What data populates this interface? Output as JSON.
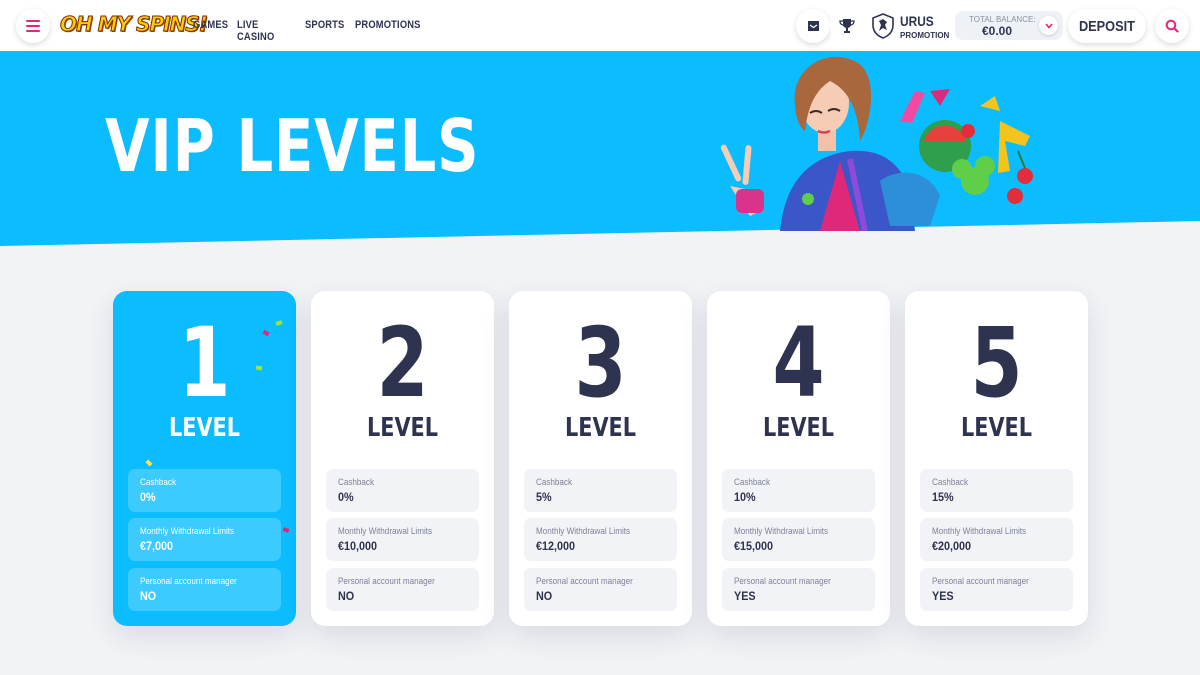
{
  "header": {
    "logo": "OH MY SPINS!",
    "nav": [
      "GAMES",
      "LIVE CASINO",
      "SPORTS",
      "PROMOTIONS"
    ],
    "user": {
      "name": "URUS",
      "status": "PROMOTION"
    },
    "balance": {
      "label": "TOTAL BALANCE:",
      "value": "€0.00"
    },
    "deposit_label": "DEPOSIT"
  },
  "hero": {
    "title": "VIP LEVELS"
  },
  "levels": [
    {
      "number": "1",
      "label": "LEVEL",
      "cashback_label": "Cashback",
      "cashback": "0%",
      "withdrawal_label": "Monthly Withdrawal Limits",
      "withdrawal": "€7,000",
      "manager_label": "Personal account manager",
      "manager": "NO"
    },
    {
      "number": "2",
      "label": "LEVEL",
      "cashback_label": "Cashback",
      "cashback": "0%",
      "withdrawal_label": "Monthly Withdrawal Limits",
      "withdrawal": "€10,000",
      "manager_label": "Personal account manager",
      "manager": "NO"
    },
    {
      "number": "3",
      "label": "LEVEL",
      "cashback_label": "Cashback",
      "cashback": "5%",
      "withdrawal_label": "Monthly Withdrawal Limits",
      "withdrawal": "€12,000",
      "manager_label": "Personal account manager",
      "manager": "NO"
    },
    {
      "number": "4",
      "label": "LEVEL",
      "cashback_label": "Cashback",
      "cashback": "10%",
      "withdrawal_label": "Monthly Withdrawal Limits",
      "withdrawal": "€15,000",
      "manager_label": "Personal account manager",
      "manager": "YES"
    },
    {
      "number": "5",
      "label": "LEVEL",
      "cashback_label": "Cashback",
      "cashback": "15%",
      "withdrawal_label": "Monthly Withdrawal Limits",
      "withdrawal": "€20,000",
      "manager_label": "Personal account manager",
      "manager": "YES"
    }
  ],
  "colors": {
    "accent": "#0bbcff",
    "brand_pink": "#e0287a",
    "text_dark": "#2e3350",
    "logo_yellow": "#ffcc00"
  },
  "icons": {
    "menu": "hamburger-icon",
    "inbox": "inbox-icon",
    "trophy": "trophy-icon",
    "rank": "shield-rank-icon",
    "chevron": "chevron-down-icon",
    "search": "search-icon"
  }
}
